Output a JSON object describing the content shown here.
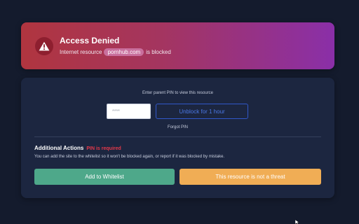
{
  "alert": {
    "title": "Access Denied",
    "message_prefix": "Internet resource",
    "domain": "pornhub.com",
    "message_suffix": "is blocked",
    "icon": "warning-icon"
  },
  "unlock": {
    "prompt": "Enter parent PIN to view this resource",
    "pin_placeholder": "****",
    "unblock_label": "Unblock for 1 hour",
    "forgot_label": "Forgot PIN"
  },
  "actions": {
    "title": "Additional Actions",
    "pin_required": "PIN is required",
    "description": "You can add the site to the whitelist so it won't be blocked again, or report if it was blocked by mistake.",
    "whitelist_label": "Add to Whitelist",
    "not_threat_label": "This resource is not a threat"
  },
  "colors": {
    "background": "#141b2d",
    "panel": "#1c2640",
    "danger": "#e6394a",
    "success": "#4ea88a",
    "warning": "#f0ad55",
    "primary": "#3157c9"
  }
}
